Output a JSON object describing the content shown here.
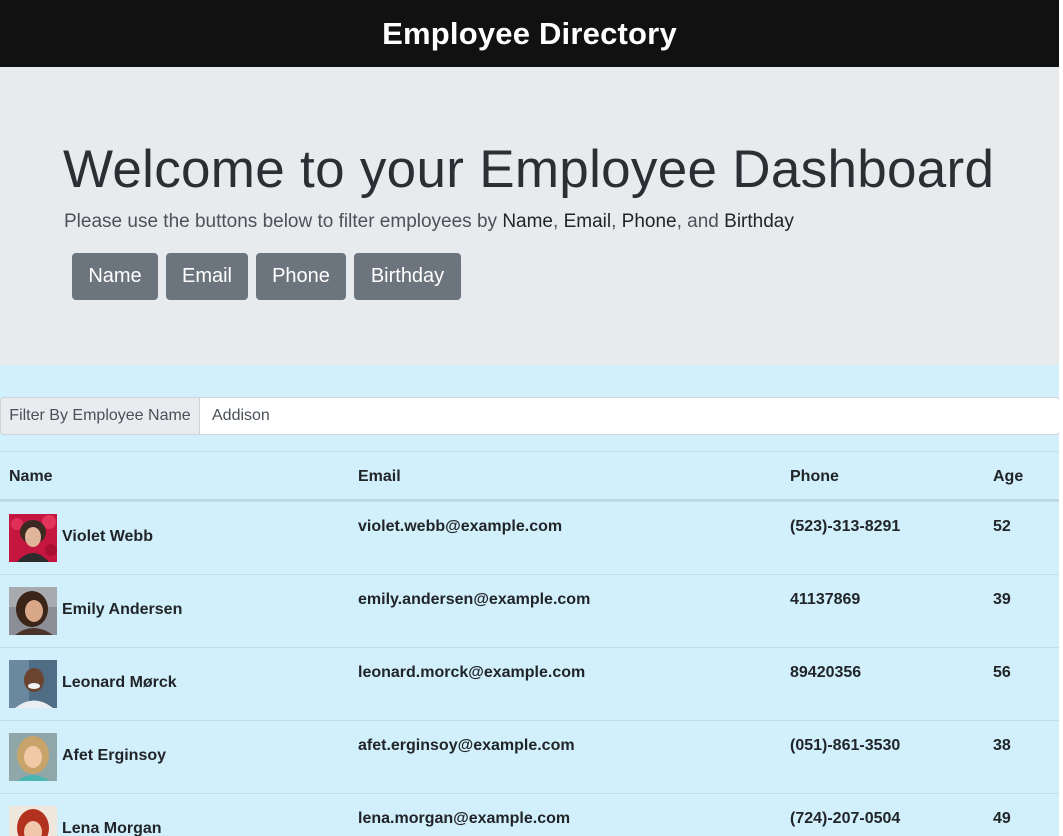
{
  "navbar": {
    "title": "Employee Directory"
  },
  "jumbotron": {
    "title": "Welcome to your Employee Dashboard",
    "lead_prefix": "Please use the buttons below to filter employees by ",
    "lead_name": "Name",
    "lead_sep1": ", ",
    "lead_email": "Email",
    "lead_sep2": ", ",
    "lead_phone": "Phone",
    "lead_sep3": ", and ",
    "lead_birthday": "Birthday"
  },
  "filter_buttons": {
    "name": "Name",
    "email": "Email",
    "phone": "Phone",
    "birthday": "Birthday"
  },
  "filter": {
    "label": "Filter By Employee Name",
    "value": "Addison"
  },
  "table": {
    "headers": {
      "name": "Name",
      "email": "Email",
      "phone": "Phone",
      "age": "Age"
    },
    "rows": [
      {
        "name": "Violet Webb",
        "email": "violet.webb@example.com",
        "phone": "(523)-313-8291",
        "age": "52"
      },
      {
        "name": "Emily Andersen",
        "email": "emily.andersen@example.com",
        "phone": "41137869",
        "age": "39"
      },
      {
        "name": "Leonard Mørck",
        "email": "leonard.morck@example.com",
        "phone": "89420356",
        "age": "56"
      },
      {
        "name": "Afet Erginsoy",
        "email": "afet.erginsoy@example.com",
        "phone": "(051)-861-3530",
        "age": "38"
      },
      {
        "name": "Lena Morgan",
        "email": "lena.morgan@example.com",
        "phone": "(724)-207-0504",
        "age": "49"
      }
    ]
  },
  "colors": {
    "navbar_bg": "#111111",
    "jumbotron_bg": "#e8ebee",
    "button_bg": "#6c757d",
    "table_bg": "#d1f0fb"
  }
}
